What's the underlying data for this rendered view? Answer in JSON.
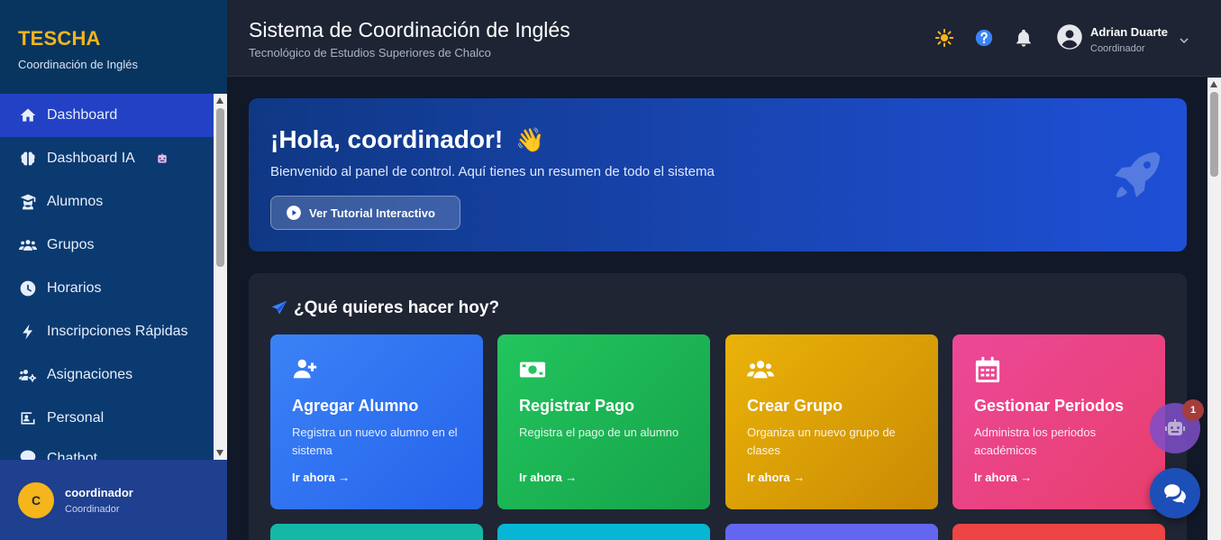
{
  "brand": {
    "title": "TESCHA",
    "subtitle": "Coordinación de Inglés"
  },
  "sidebar": {
    "items": [
      {
        "label": "Dashboard",
        "icon": "home-icon",
        "active": true
      },
      {
        "label": "Dashboard IA",
        "icon": "brain-icon",
        "badge_icon": "robot-icon"
      },
      {
        "label": "Alumnos",
        "icon": "graduate-icon"
      },
      {
        "label": "Grupos",
        "icon": "users-icon"
      },
      {
        "label": "Horarios",
        "icon": "clock-icon"
      },
      {
        "label": "Inscripciones Rápidas",
        "icon": "bolt-icon"
      },
      {
        "label": "Asignaciones",
        "icon": "users-cog-icon"
      },
      {
        "label": "Personal",
        "icon": "id-card-icon"
      },
      {
        "label": "Chatbot",
        "icon": "comment-icon"
      }
    ],
    "user": {
      "initial": "C",
      "name": "coordinador",
      "role": "Coordinador"
    }
  },
  "header": {
    "title": "Sistema de Coordinación de Inglés",
    "subtitle": "Tecnológico de Estudios Superiores de Chalco",
    "user": {
      "name": "Adrian Duarte",
      "role": "Coordinador"
    }
  },
  "hero": {
    "title": "¡Hola, coordinador!",
    "wave": "👋",
    "subtitle": "Bienvenido al panel de control. Aquí tienes un resumen de todo el sistema",
    "button": "Ver Tutorial Interactivo"
  },
  "quick_actions": {
    "title": "¿Qué quieres hacer hoy?",
    "cards": [
      {
        "title": "Agregar Alumno",
        "desc": "Registra un nuevo alumno en el sistema",
        "link": "Ir ahora →",
        "icon": "user-plus-icon"
      },
      {
        "title": "Registrar Pago",
        "desc": "Registra el pago de un alumno",
        "link": "Ir ahora →",
        "icon": "money-bill-icon"
      },
      {
        "title": "Crear Grupo",
        "desc": "Organiza un nuevo grupo de clases",
        "link": "Ir ahora →",
        "icon": "users-icon"
      },
      {
        "title": "Gestionar Periodos",
        "desc": "Administra los periodos académicos",
        "link": "Ir ahora →",
        "icon": "calendar-icon"
      }
    ]
  },
  "floating": {
    "bot_badge": "1"
  },
  "colors": {
    "accent": "#f5b51b",
    "sidebar": "#0b3a70",
    "active": "#2341c5",
    "header": "#1e2433",
    "background": "#111827"
  }
}
